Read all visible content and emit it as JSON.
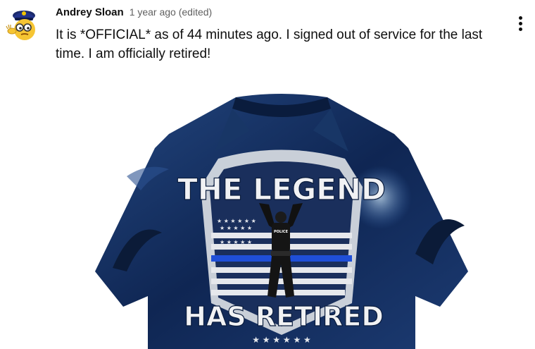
{
  "comment": {
    "author": "Andrey Sloan",
    "timestamp": "1 year ago (edited)",
    "text": "It is *OFFICIAL* as of 44 minutes ago. I signed out of service for the last time. I am officially retired!",
    "avatar_icon": "police-emoji-avatar",
    "menu_icon": "more-vertical-icon"
  },
  "image": {
    "headline_top": "THE LEGEND",
    "headline_bottom": "HAS RETIRED",
    "vest_label": "POLICE"
  },
  "colors": {
    "shirt_dark": "#0c1f45",
    "shirt_mid": "#1d3f7a",
    "thin_blue_line": "#1f4fd8",
    "badge_silver": "#d9dde3"
  }
}
